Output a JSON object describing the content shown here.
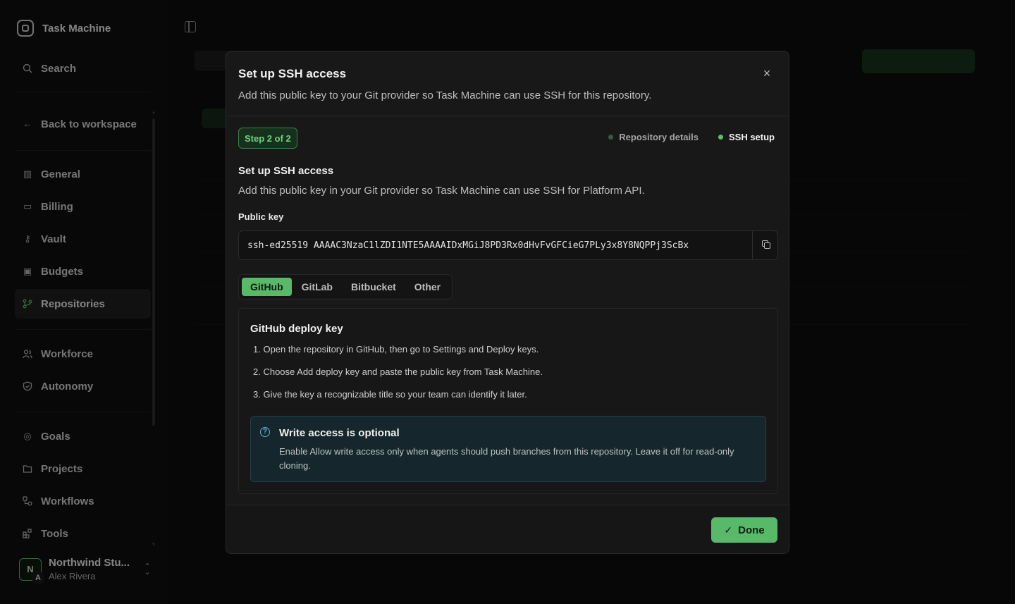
{
  "app": {
    "name": "Task Machine"
  },
  "sidebar": {
    "search_label": "Search",
    "back_label": "Back to workspace",
    "items": [
      {
        "label": "General",
        "icon": "building-icon"
      },
      {
        "label": "Billing",
        "icon": "credit-card-icon"
      },
      {
        "label": "Vault",
        "icon": "key-icon"
      },
      {
        "label": "Budgets",
        "icon": "wallet-icon"
      },
      {
        "label": "Repositories",
        "icon": "git-branch-icon",
        "active": true
      },
      {
        "label": "Workforce",
        "icon": "users-icon"
      },
      {
        "label": "Autonomy",
        "icon": "shield-icon"
      },
      {
        "label": "Goals",
        "icon": "target-icon"
      },
      {
        "label": "Projects",
        "icon": "folder-icon"
      },
      {
        "label": "Workflows",
        "icon": "workflow-icon"
      },
      {
        "label": "Tools",
        "icon": "tools-icon"
      }
    ],
    "org": {
      "name": "Northwind Stu...",
      "user": "Alex Rivera",
      "initial": "N",
      "user_initial": "A"
    }
  },
  "modal": {
    "title": "Set up SSH access",
    "description": "Add this public key to your Git provider so Task Machine can use SSH for this repository.",
    "step_badge": "Step 2 of 2",
    "steps": [
      "Repository details",
      "SSH setup"
    ],
    "section_title": "Set up SSH access",
    "section_description": "Add this public key in your Git provider so Task Machine can use SSH for Platform API.",
    "public_key_label": "Public key",
    "public_key": "ssh-ed25519 AAAAC3NzaC1lZDI1NTE5AAAAIDxMGiJ8PD3Rx0dHvFvGFCieG7PLy3x8Y8NQPPj3ScBx",
    "providers": [
      "GitHub",
      "GitLab",
      "Bitbucket",
      "Other"
    ],
    "active_provider": "GitHub",
    "card_title": "GitHub deploy key",
    "instructions": [
      "1. Open the repository in GitHub, then go to Settings and Deploy keys.",
      "2. Choose Add deploy key and paste the public key from Task Machine.",
      "3. Give the key a recognizable title so your team can identify it later."
    ],
    "callout": {
      "title": "Write access is optional",
      "body": "Enable Allow write access only when agents should push branches from this repository. Leave it off for read-only cloning."
    },
    "done_label": "Done"
  },
  "colors": {
    "accent": "#58b969",
    "info": "#5fb7d4"
  }
}
